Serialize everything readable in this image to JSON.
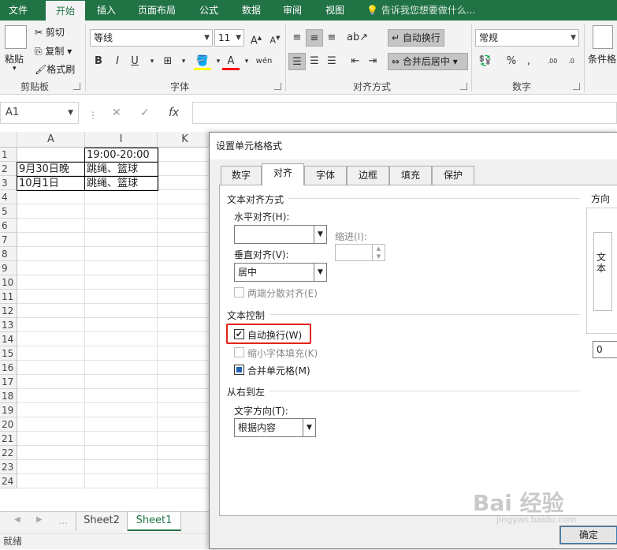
{
  "ribbon_tabs": [
    "文件",
    "开始",
    "插入",
    "页面布局",
    "公式",
    "数据",
    "审阅",
    "视图"
  ],
  "tell_me": "告诉我您想要做什么...",
  "clipboard": {
    "paste": "粘贴",
    "cut": "剪切",
    "copy": "复制",
    "format_painter": "格式刷",
    "label": "剪贴板"
  },
  "font": {
    "name": "等线",
    "size": "11",
    "label": "字体",
    "bold": "B",
    "italic": "I",
    "underline": "U"
  },
  "alignment": {
    "wrap_text": "自动换行",
    "merge_center": "合并后居中",
    "label": "对齐方式"
  },
  "number": {
    "format": "常规",
    "label": "数字",
    "percent": "%"
  },
  "styles": {
    "conditional": "条件格"
  },
  "formula_bar": {
    "name_box": "A1",
    "fx": "fx"
  },
  "sheet": {
    "columns": [
      "A",
      "I",
      "K"
    ],
    "rows": [
      "1",
      "2",
      "3",
      "4",
      "5",
      "6",
      "7",
      "8",
      "9",
      "10",
      "11",
      "12",
      "13",
      "14",
      "15",
      "16",
      "17",
      "18",
      "19",
      "20",
      "21",
      "22",
      "23",
      "24"
    ],
    "cells": {
      "I1": "19:00-20:00",
      "A2": "9月30日晚",
      "I2": "跳绳、篮球",
      "A3": "10月1日",
      "I3": "跳绳、篮球"
    },
    "tabs": [
      "Sheet2",
      "Sheet1"
    ],
    "active_tab": "Sheet1"
  },
  "status": "就绪",
  "dialog": {
    "title": "设置单元格格式",
    "tabs": [
      "数字",
      "对齐",
      "字体",
      "边框",
      "填充",
      "保护"
    ],
    "active_tab": "对齐",
    "text_alignment": {
      "heading": "文本对齐方式",
      "horizontal_label": "水平对齐(H):",
      "horizontal_value": "",
      "indent_label": "缩进(I):",
      "indent_value": "",
      "vertical_label": "垂直对齐(V):",
      "vertical_value": "居中",
      "justify_distributed": "两端分散对齐(E)"
    },
    "text_control": {
      "heading": "文本控制",
      "wrap_text": "自动换行(W)",
      "wrap_checked": true,
      "shrink_to_fit": "缩小字体填充(K)",
      "merge_cells": "合并单元格(M)"
    },
    "rtl": {
      "heading": "从右到左",
      "direction_label": "文字方向(T):",
      "direction_value": "根据内容"
    },
    "orientation": {
      "heading": "方向",
      "text": "文本",
      "degrees": "0"
    },
    "ok": "确定"
  },
  "watermark": {
    "brand": "Bai 经验",
    "url": "jingyan.baidu.com"
  },
  "colors": {
    "excel_green": "#217346",
    "highlight_red": "#e3231b"
  }
}
